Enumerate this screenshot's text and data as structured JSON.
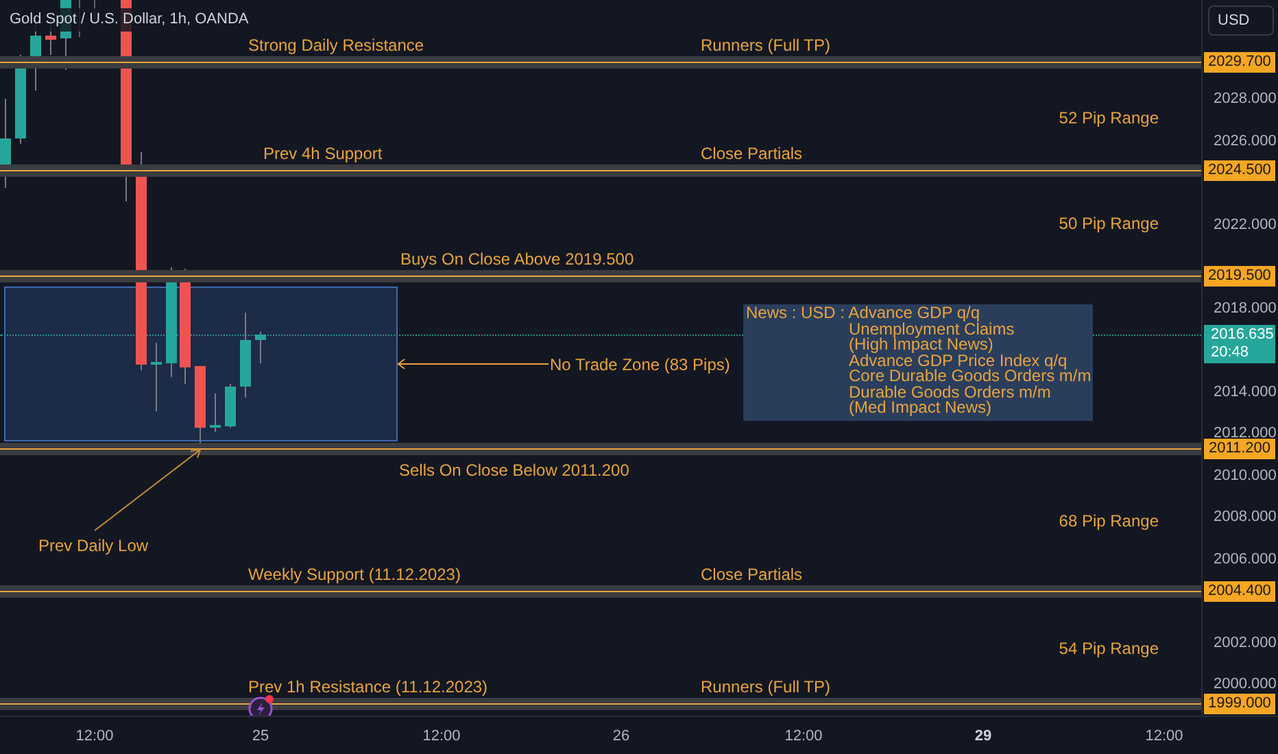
{
  "header": {
    "title": "Gold Spot / U.S. Dollar, 1h, OANDA",
    "currency_button": "USD"
  },
  "levels": [
    {
      "price": "2029.700",
      "left_label": "Strong Daily Resistance",
      "right_label": "Runners (Full TP)",
      "range_below": "52 Pip Range"
    },
    {
      "price": "2024.500",
      "left_label": "Prev 4h Support",
      "right_label": "Close Partials",
      "range_below": "50 Pip Range"
    },
    {
      "price": "2019.500",
      "left_label": "Buys On Close Above 2019.500"
    },
    {
      "price": "2011.200",
      "left_label": "Sells On Close Below 2011.200",
      "range_below": "68 Pip Range"
    },
    {
      "price": "2004.400",
      "left_label": "Weekly Support (11.12.2023)",
      "right_label": "Close Partials",
      "range_below": "54 Pip Range"
    },
    {
      "price": "1999.000",
      "left_label": "Prev 1h Resistance (11.12.2023)",
      "right_label": "Runners (Full TP)"
    }
  ],
  "price_axis": {
    "ticks": [
      "2028.000",
      "2026.000",
      "2022.000",
      "2018.000",
      "2014.000",
      "2012.000",
      "2010.000",
      "2008.000",
      "2006.000",
      "2002.000",
      "2000.000"
    ]
  },
  "current_price": {
    "price": "2016.635",
    "countdown": "20:48"
  },
  "trade_zone": {
    "label": "No Trade Zone (83 Pips)"
  },
  "callout": {
    "label": "Prev Daily Low"
  },
  "news": {
    "lines": [
      "News : USD : Advance GDP q/q",
      "Unemployment Claims",
      "(High Impact News)",
      "Advance GDP Price Index q/q",
      "Core Durable Goods Orders m/m",
      "Durable Goods Orders m/m",
      "(Med Impact News)"
    ]
  },
  "time_axis": {
    "labels": [
      {
        "text": "12:00",
        "bold": false
      },
      {
        "text": "25",
        "bold": false
      },
      {
        "text": "12:00",
        "bold": false
      },
      {
        "text": "26",
        "bold": false
      },
      {
        "text": "12:00",
        "bold": false
      },
      {
        "text": "29",
        "bold": true
      },
      {
        "text": "12:00",
        "bold": false
      }
    ]
  }
}
